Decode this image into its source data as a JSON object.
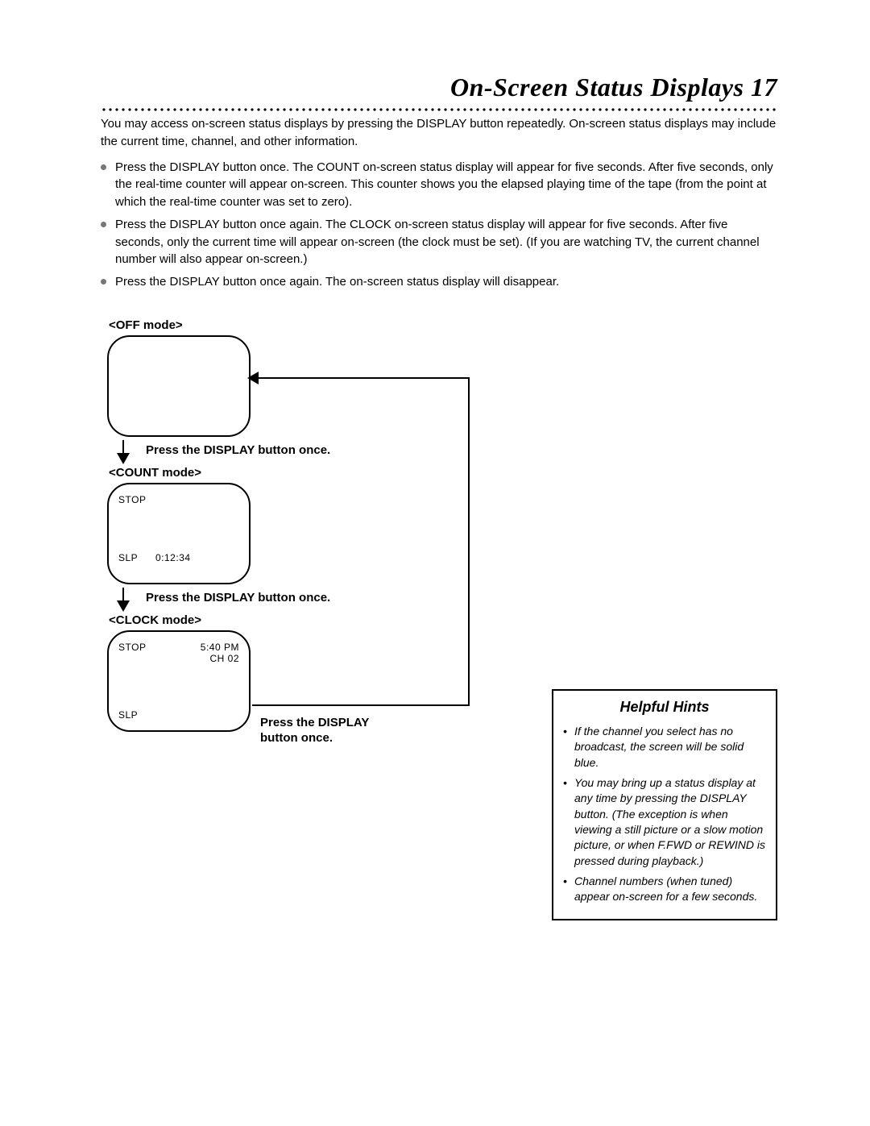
{
  "page": {
    "title": "On-Screen Status Displays 17",
    "intro": "You may access on-screen status displays by pressing the DISPLAY button repeatedly. On-screen status displays may include the current time, channel, and other information.",
    "bullets": [
      "Press the DISPLAY button once. The COUNT on-screen status display will appear for five seconds. After five seconds, only the real-time counter will appear on-screen. This counter shows you the elapsed playing time of the tape (from the point at which the real-time counter was set to zero).",
      "Press the DISPLAY button once again. The CLOCK on-screen status display will appear for five seconds. After five seconds, only the current time will appear on-screen (the clock must be set). (If you are watching TV, the current channel number will also appear on-screen.)",
      "Press the DISPLAY button once again. The on-screen status display will disappear."
    ]
  },
  "diagram": {
    "off": {
      "label": "<OFF mode>"
    },
    "count": {
      "label": "<COUNT mode>",
      "status": "STOP",
      "speed": "SLP",
      "counter": "0:12:34"
    },
    "clock": {
      "label": "<CLOCK mode>",
      "status": "STOP",
      "time": "5:40 PM",
      "channel": "CH 02",
      "speed": "SLP"
    },
    "step1": "Press the DISPLAY button once.",
    "step2": "Press the DISPLAY button once.",
    "step3": "Press the DISPLAY button once."
  },
  "hints": {
    "title": "Helpful Hints",
    "items": [
      "If the channel you select has no broadcast, the screen will be solid blue.",
      "You may bring up a status display at any time by pressing the DISPLAY button. (The exception is when viewing a still picture or a slow motion picture, or when F.FWD or REWIND is pressed during playback.)",
      "Channel numbers (when tuned) appear on-screen for a few seconds."
    ]
  }
}
